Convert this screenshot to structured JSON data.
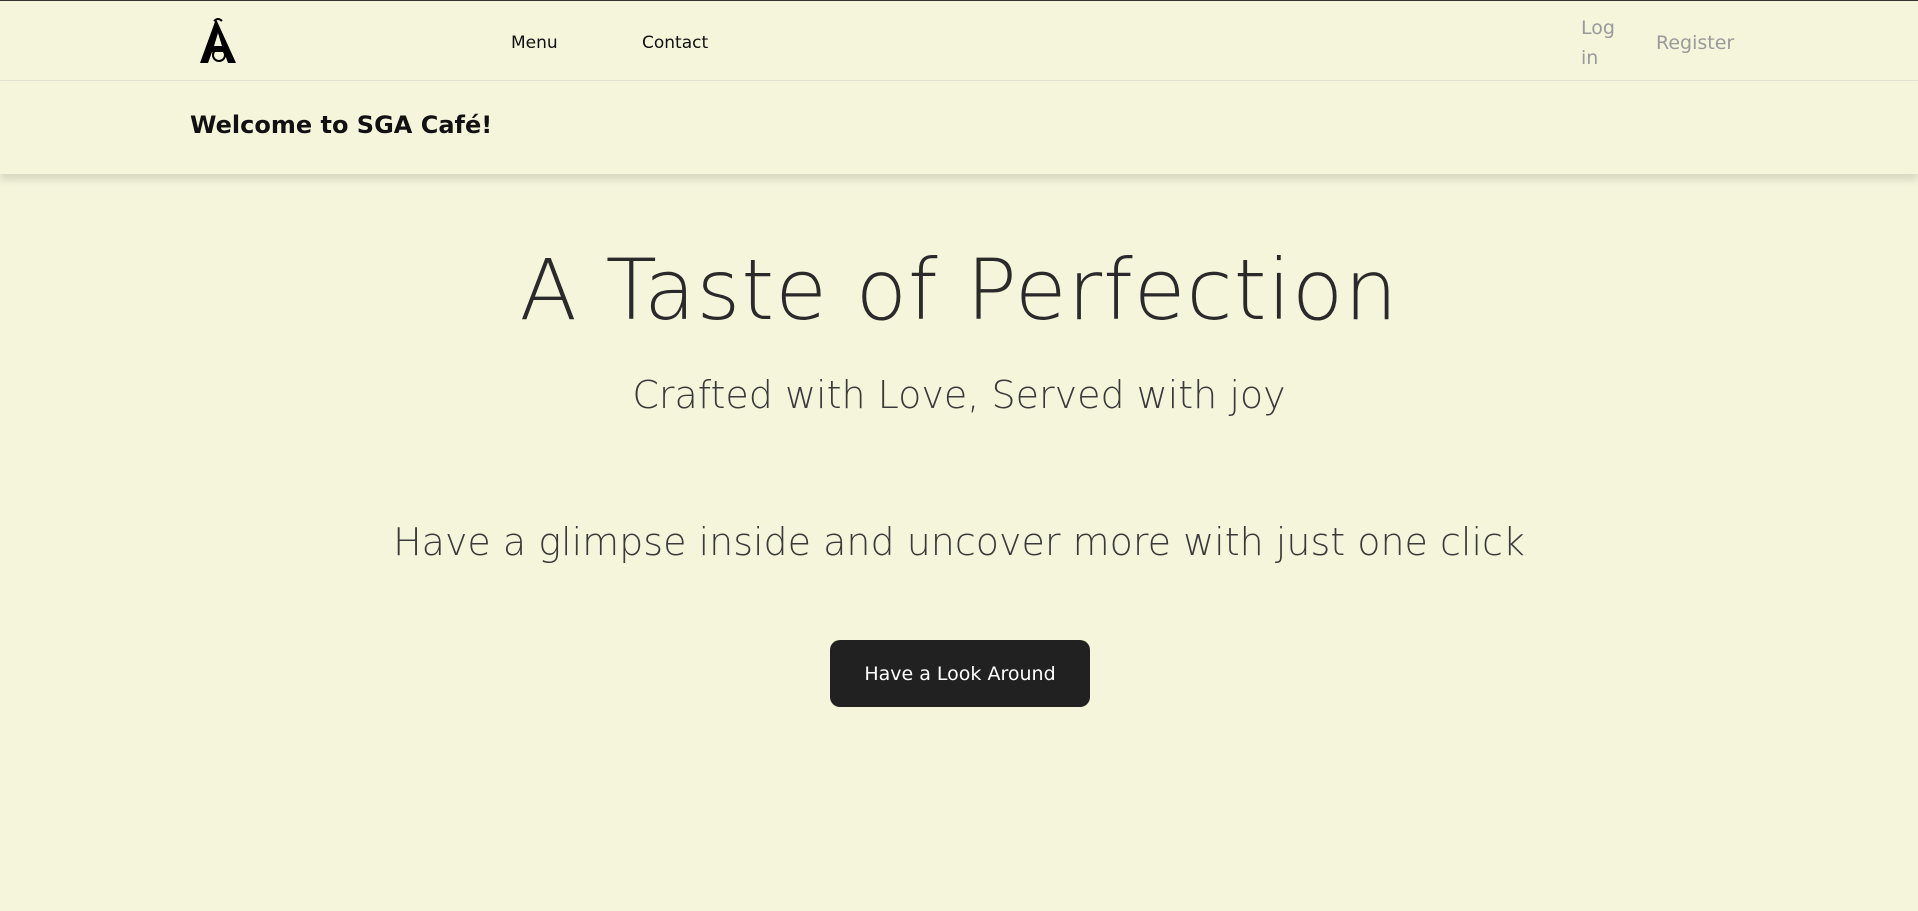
{
  "nav": {
    "brand_logo": "A",
    "links": [
      "Menu",
      "Contact"
    ],
    "login": "Log in",
    "register": "Register"
  },
  "welcome": "Welcome to SGA Café!",
  "hero": {
    "title": "A Taste of Perfection",
    "subtitle": "Crafted with Love, Served with joy",
    "glimpse": "Have a glimpse inside and uncover more with just one click",
    "cta_label": "Have a Look Around"
  },
  "colors": {
    "background": "#f5f5dc",
    "text": "#212529",
    "button": "#212121",
    "muted": "#9a9a9a"
  }
}
